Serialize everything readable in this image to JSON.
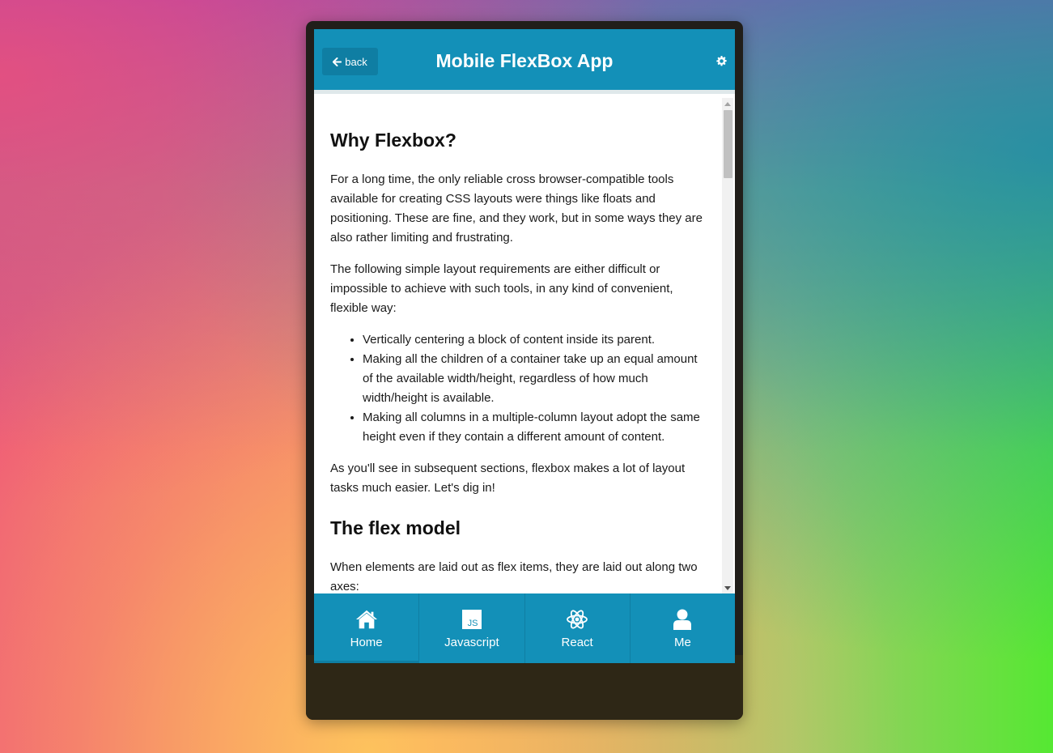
{
  "header": {
    "back_label": "back",
    "title": "Mobile FlexBox App"
  },
  "article": {
    "heading1": "Why Flexbox?",
    "para1": "For a long time, the only reliable cross browser-compatible tools available for creating CSS layouts were things like floats and positioning. These are fine, and they work, but in some ways they are also rather limiting and frustrating.",
    "para2": "The following simple layout requirements are either difficult or impossible to achieve with such tools, in any kind of convenient, flexible way:",
    "list": [
      "Vertically centering a block of content inside its parent.",
      "Making all the children of a container take up an equal amount of the available width/height, regardless of how much width/height is available.",
      "Making all columns in a multiple-column layout adopt the same height even if they contain a different amount of content."
    ],
    "para3": "As you'll see in subsequent sections, flexbox makes a lot of layout tasks much easier. Let's dig in!",
    "heading2": "The flex model",
    "para4": "When elements are laid out as flex items, they are laid out along two axes:"
  },
  "tabs": [
    {
      "label": "Home",
      "icon": "home-icon",
      "active": true
    },
    {
      "label": "Javascript",
      "icon": "js-icon",
      "active": false
    },
    {
      "label": "React",
      "icon": "react-icon",
      "active": false
    },
    {
      "label": "Me",
      "icon": "user-icon",
      "active": false
    }
  ],
  "colors": {
    "header": "#1390b8",
    "tabbar": "#1390b8",
    "back_button": "#0f7ea3"
  }
}
